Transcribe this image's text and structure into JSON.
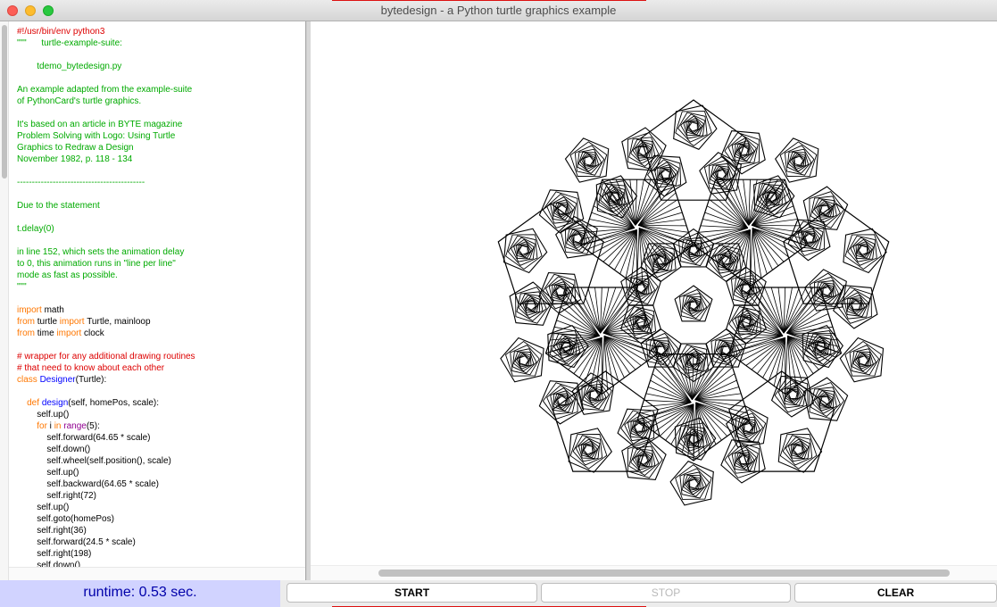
{
  "window": {
    "title": "bytedesign - a Python turtle graphics example"
  },
  "code_lines": [
    [
      {
        "t": "#!/usr/bin/env python3",
        "c": "red"
      }
    ],
    [
      {
        "t": "\"\"\"      turtle-example-suite:",
        "c": "green"
      }
    ],
    [],
    [
      {
        "t": "        tdemo_bytedesign.py",
        "c": "green"
      }
    ],
    [],
    [
      {
        "t": "An example adapted from the example-suite",
        "c": "green"
      }
    ],
    [
      {
        "t": "of PythonCard's turtle graphics.",
        "c": "green"
      }
    ],
    [],
    [
      {
        "t": "It's based on an article in BYTE magazine",
        "c": "green"
      }
    ],
    [
      {
        "t": "Problem Solving with Logo: Using Turtle",
        "c": "green"
      }
    ],
    [
      {
        "t": "Graphics to Redraw a Design",
        "c": "green"
      }
    ],
    [
      {
        "t": "November 1982, p. 118 - 134",
        "c": "green"
      }
    ],
    [],
    [
      {
        "t": "-------------------------------------------",
        "c": "green"
      }
    ],
    [],
    [
      {
        "t": "Due to the statement",
        "c": "green"
      }
    ],
    [],
    [
      {
        "t": "t.delay(0)",
        "c": "green"
      }
    ],
    [],
    [
      {
        "t": "in line 152, which sets the animation delay",
        "c": "green"
      }
    ],
    [
      {
        "t": "to 0, this animation runs in \"line per line\"",
        "c": "green"
      }
    ],
    [
      {
        "t": "mode as fast as possible.",
        "c": "green"
      }
    ],
    [
      {
        "t": "\"\"\"",
        "c": "green"
      }
    ],
    [],
    [
      {
        "t": "import",
        "c": "orange"
      },
      {
        "t": " math",
        "c": ""
      }
    ],
    [
      {
        "t": "from",
        "c": "orange"
      },
      {
        "t": " turtle ",
        "c": ""
      },
      {
        "t": "import",
        "c": "orange"
      },
      {
        "t": " Turtle, mainloop",
        "c": ""
      }
    ],
    [
      {
        "t": "from",
        "c": "orange"
      },
      {
        "t": " time ",
        "c": ""
      },
      {
        "t": "import",
        "c": "orange"
      },
      {
        "t": " clock",
        "c": ""
      }
    ],
    [],
    [
      {
        "t": "# wrapper for any additional drawing routines",
        "c": "red"
      }
    ],
    [
      {
        "t": "# that need to know about each other",
        "c": "red"
      }
    ],
    [
      {
        "t": "class",
        "c": "orange"
      },
      {
        "t": " ",
        "c": ""
      },
      {
        "t": "Designer",
        "c": "blue"
      },
      {
        "t": "(Turtle):",
        "c": ""
      }
    ],
    [],
    [
      {
        "t": "    ",
        "c": ""
      },
      {
        "t": "def",
        "c": "orange"
      },
      {
        "t": " ",
        "c": ""
      },
      {
        "t": "design",
        "c": "blue"
      },
      {
        "t": "(self, homePos, scale):",
        "c": ""
      }
    ],
    [
      {
        "t": "        self.up()",
        "c": ""
      }
    ],
    [
      {
        "t": "        ",
        "c": ""
      },
      {
        "t": "for",
        "c": "orange"
      },
      {
        "t": " i ",
        "c": ""
      },
      {
        "t": "in",
        "c": "orange"
      },
      {
        "t": " ",
        "c": ""
      },
      {
        "t": "range",
        "c": "purple"
      },
      {
        "t": "(5):",
        "c": ""
      }
    ],
    [
      {
        "t": "            self.forward(64.65 * scale)",
        "c": ""
      }
    ],
    [
      {
        "t": "            self.down()",
        "c": ""
      }
    ],
    [
      {
        "t": "            self.wheel(self.position(), scale)",
        "c": ""
      }
    ],
    [
      {
        "t": "            self.up()",
        "c": ""
      }
    ],
    [
      {
        "t": "            self.backward(64.65 * scale)",
        "c": ""
      }
    ],
    [
      {
        "t": "            self.right(72)",
        "c": ""
      }
    ],
    [
      {
        "t": "        self.up()",
        "c": ""
      }
    ],
    [
      {
        "t": "        self.goto(homePos)",
        "c": ""
      }
    ],
    [
      {
        "t": "        self.right(36)",
        "c": ""
      }
    ],
    [
      {
        "t": "        self.forward(24.5 * scale)",
        "c": ""
      }
    ],
    [
      {
        "t": "        self.right(198)",
        "c": ""
      }
    ],
    [
      {
        "t": "        self.down()",
        "c": ""
      }
    ]
  ],
  "status": {
    "runtime": "runtime: 0.53 sec."
  },
  "buttons": {
    "start": "START",
    "stop": "STOP",
    "clear": "CLEAR"
  },
  "colors": {
    "keyword": "#ff7700",
    "comment": "#dd0000",
    "string": "#00aa00",
    "definition": "#0000ff",
    "builtin": "#900090",
    "runtime_bg": "#d1d3ff",
    "runtime_text": "#0000aa",
    "stroke": "#000000"
  }
}
